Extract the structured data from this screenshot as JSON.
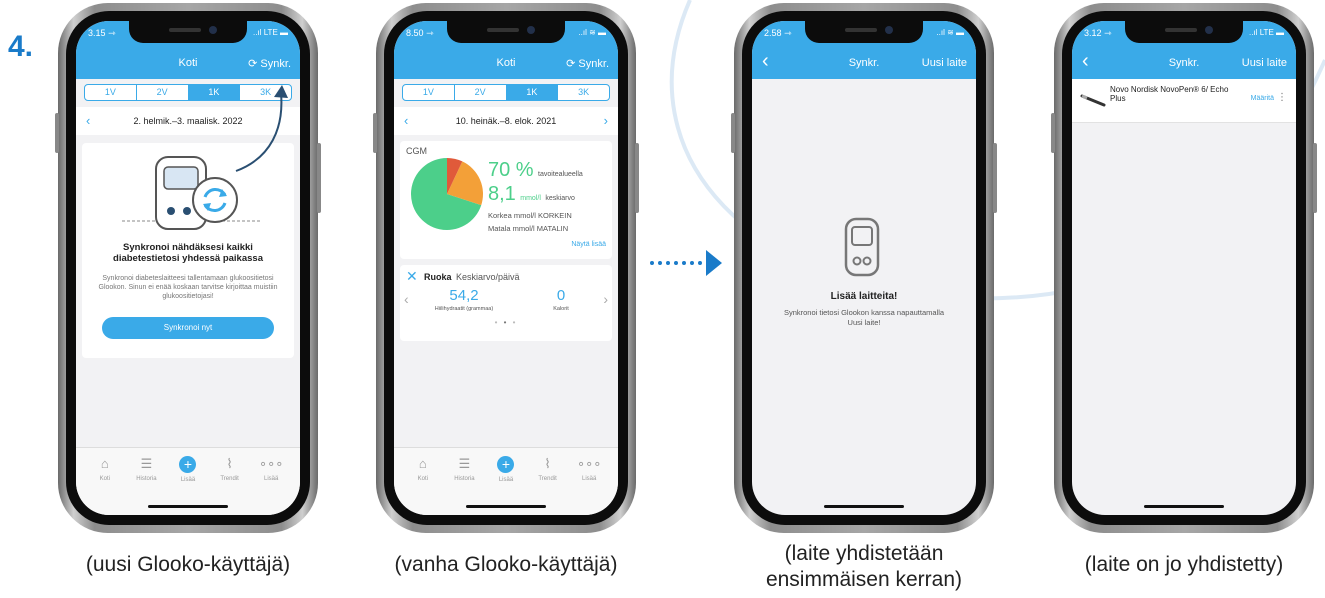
{
  "step_number": "4.",
  "colors": {
    "accent": "#3aaae8",
    "step": "#1a7bc9",
    "green": "#4ccf8a",
    "orange": "#f3a038",
    "red": "#e05a3a"
  },
  "phones": [
    {
      "caption": "(uusi Glooko-käyttäjä)",
      "status": {
        "time": "3.15 ⇾",
        "signal": "..ıl LTE ▬"
      },
      "header": {
        "title": "Koti",
        "right": "⟳ Synkr."
      },
      "segments": [
        "1V",
        "2V",
        "1K",
        "3K"
      ],
      "active_segment": "1K",
      "date_range": "2. helmik.–3. maalisk. 2022",
      "sync_card": {
        "heading": "Synkronoi nähdäksesi kaikki diabetestietosi yhdessä paikassa",
        "body": "Synkronoi diabeteslaitteesi tallentamaan glukoositietosi Glookon. Sinun ei enää koskaan tarvitse kirjoittaa muistiin glukoositietojasi!",
        "button": "Synkronoi nyt"
      },
      "tabs": [
        "Koti",
        "Historia",
        "Lisää",
        "Trendit",
        "Lisää"
      ]
    },
    {
      "caption": "(vanha Glooko-käyttäjä)",
      "status": {
        "time": "8.50 ⇾",
        "signal": "..ıl ≋ ▬"
      },
      "header": {
        "title": "Koti",
        "right": "⟳ Synkr."
      },
      "segments": [
        "1V",
        "2V",
        "1K",
        "3K"
      ],
      "active_segment": "1K",
      "date_range": "10. heinäk.–8. elok. 2021",
      "cgm": {
        "label": "CGM",
        "pct_value": "70 %",
        "pct_label": "tavoitealueella",
        "avg_value": "8,1",
        "avg_unit": "mmol/l",
        "avg_label": "keskiarvo",
        "high": "Korkea mmol/l KORKEIN",
        "low": "Matala mmol/l MATALIN",
        "more": "Näytä lisää",
        "pie": [
          {
            "label": "green",
            "value": 70
          },
          {
            "label": "orange",
            "value": 23
          },
          {
            "label": "red",
            "value": 7
          }
        ]
      },
      "food": {
        "label": "Ruoka",
        "sublabel": "Keskiarvo/päivä",
        "carbs_value": "54,2",
        "carbs_label": "Hiilihydraatit (grammaa)",
        "cal_value": "0",
        "cal_label": "Kalorit"
      },
      "tabs": [
        "Koti",
        "Historia",
        "Lisää",
        "Trendit",
        "Lisää"
      ]
    },
    {
      "caption_line1": "(laite yhdistetään",
      "caption_line2": "ensimmäisen kerran)",
      "status": {
        "time": "2.58 ⇾",
        "signal": "..ıl ≋ ▬"
      },
      "header": {
        "title": "Synkr.",
        "right": "Uusi laite"
      },
      "empty": {
        "heading": "Lisää laitteita!",
        "body": "Synkronoi tietosi Glookon kanssa napauttamalla Uusi laite!"
      }
    },
    {
      "caption": "(laite on jo yhdistetty)",
      "status": {
        "time": "3.12 ⇾",
        "signal": "..ıl LTE ▬"
      },
      "header": {
        "title": "Synkr.",
        "right": "Uusi laite"
      },
      "device": {
        "name": "Novo Nordisk NovoPen® 6/ Echo Plus",
        "action": "Määritä",
        "menu": "⋮"
      }
    }
  ]
}
